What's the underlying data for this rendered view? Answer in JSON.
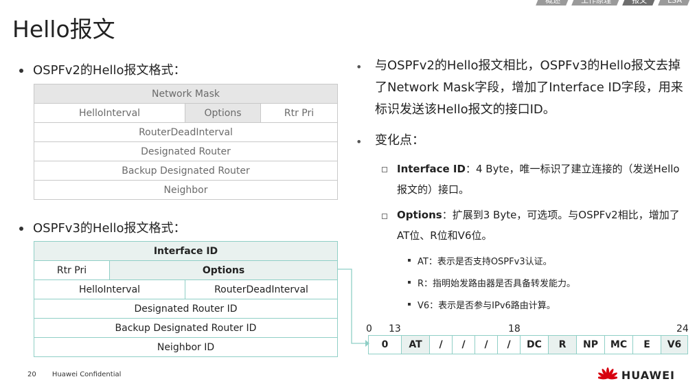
{
  "nav": [
    "概述",
    "工作原理",
    "报文",
    "LSA"
  ],
  "title": "Hello报文",
  "v2_heading": "OSPFv2的Hello报文格式：",
  "v3_heading": "OSPFv3的Hello报文格式：",
  "v2_table": {
    "network_mask": "Network Mask",
    "hello_interval": "HelloInterval",
    "options": "Options",
    "rtr_pri": "Rtr Pri",
    "router_dead": "RouterDeadInterval",
    "dr": "Designated Router",
    "bdr": "Backup Designated Router",
    "neighbor": "Neighbor"
  },
  "v3_table": {
    "interface_id": "Interface ID",
    "rtr_pri": "Rtr Pri",
    "options": "Options",
    "hello_interval": "HelloInterval",
    "router_dead": "RouterDeadInterval",
    "dr": "Designated Router ID",
    "bdr": "Backup Designated Router ID",
    "neighbor": "Neighbor ID"
  },
  "right": {
    "p1": "与OSPFv2的Hello报文相比，OSPFv3的Hello报文去掉了Network Mask字段，增加了Interface ID字段，用来标识发送该Hello报文的接口ID。",
    "p2": "变化点：",
    "s1_label": "Interface ID",
    "s1_text": "：4 Byte，唯一标识了建立连接的（发送Hello报文的）接口。",
    "s2_label": "Options",
    "s2_text": "：扩展到3 Byte，可选项。与OSPFv2相比，增加了AT位、R位和V6位。",
    "t1": "AT：表示是否支持OSPFv3认证。",
    "t2": "R：指明始发路由器是否具备转发能力。",
    "t3": "V6：表示是否参与IPv6路由计算。"
  },
  "bits": {
    "labels": [
      "0",
      "13",
      "18",
      "24"
    ],
    "cells": [
      "0",
      "AT",
      "/",
      "/",
      "/",
      "/",
      "DC",
      "R",
      "NP",
      "MC",
      "E",
      "V6"
    ]
  },
  "footer": {
    "page": "20",
    "text": "Huawei Confidential"
  },
  "logo": "HUAWEI",
  "colors": {
    "accent": "#8fcfc6",
    "logo_red": "#d7000f"
  }
}
